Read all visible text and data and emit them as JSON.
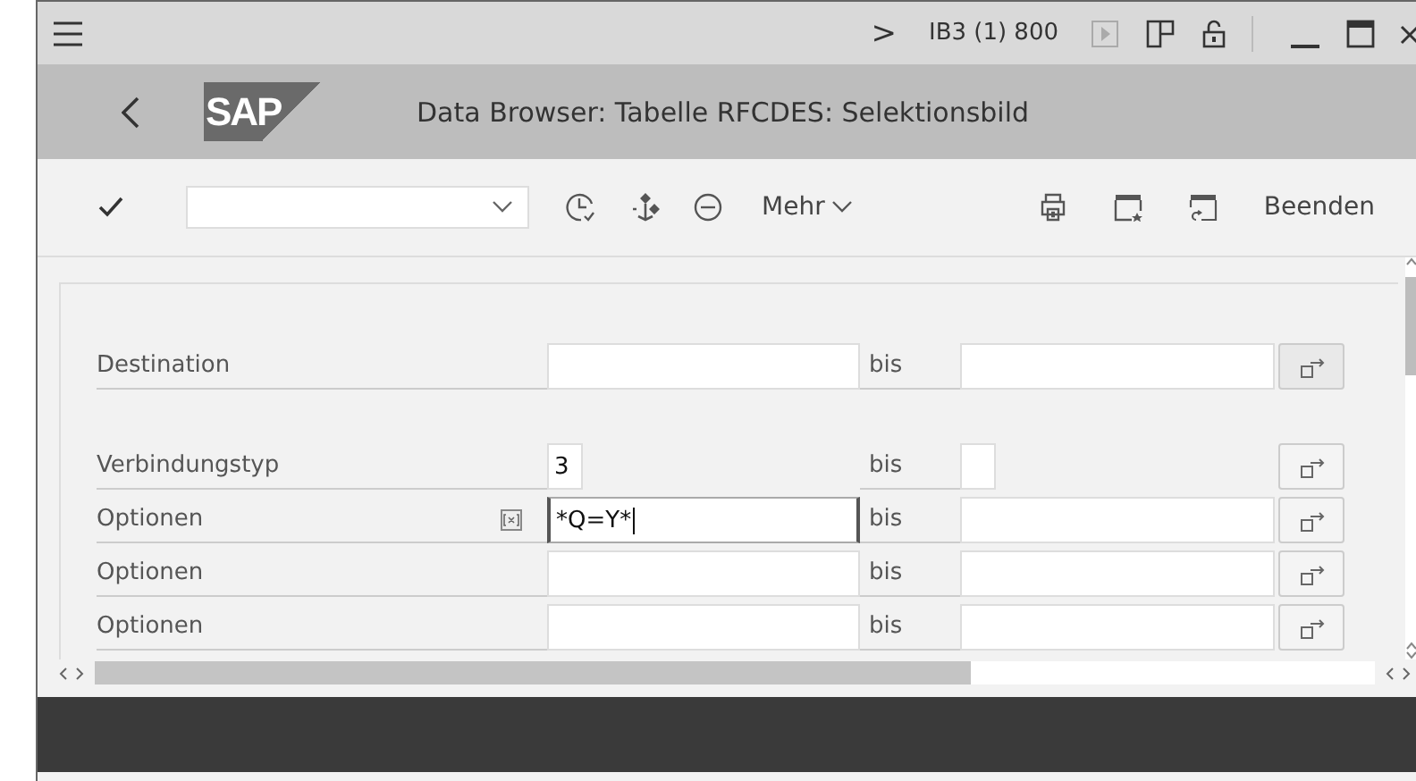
{
  "system_bar": {
    "chevron": ">",
    "system": "IB3 (1) 800"
  },
  "title_bar": {
    "logo": "SAP",
    "title": "Data Browser: Tabelle RFCDES: Selektionsbild"
  },
  "toolbar": {
    "more": "Mehr",
    "exit": "Beenden"
  },
  "groups": [
    [
      {
        "label": "Destination",
        "bis": "bis",
        "kind": "full",
        "focused": false
      }
    ],
    [
      {
        "label": "Verbindungstyp",
        "from": "3",
        "bis": "bis",
        "kind": "short",
        "focused": false
      },
      {
        "label": "Optionen",
        "from": "*Q=Y*",
        "bis": "bis",
        "kind": "full",
        "focused": true
      },
      {
        "label": "Optionen",
        "bis": "bis",
        "kind": "full",
        "focused": false
      },
      {
        "label": "Optionen",
        "bis": "bis",
        "kind": "full",
        "focused": false
      }
    ]
  ]
}
